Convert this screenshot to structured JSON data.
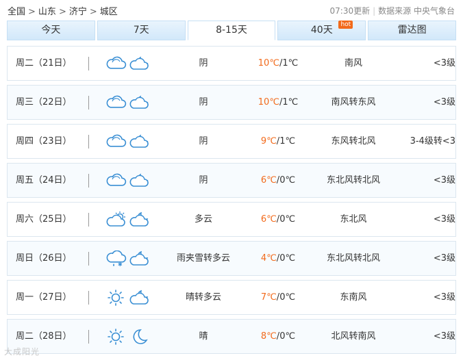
{
  "breadcrumb": {
    "items": [
      "全国",
      "山东",
      "济宁",
      "城区"
    ],
    "separator": ">"
  },
  "update": {
    "time": "07:30更新",
    "source": "数据来源 中央气象台"
  },
  "tabs": [
    {
      "label": "今天",
      "active": false
    },
    {
      "label": "7天",
      "active": false
    },
    {
      "label": "8-15天",
      "active": true
    },
    {
      "label": "40天",
      "active": false,
      "badge": "hot"
    },
    {
      "label": "雷达图",
      "active": false
    }
  ],
  "forecast": [
    {
      "day": "周二（21日）",
      "icon_day": "cloudy-icon",
      "icon_night": "cloudy-moon-icon",
      "desc": "阴",
      "hi": "10℃",
      "lo": "1℃",
      "wind": "南风",
      "level": "<3级"
    },
    {
      "day": "周三（22日）",
      "icon_day": "cloudy-icon",
      "icon_night": "cloudy-moon-icon",
      "desc": "阴",
      "hi": "10℃",
      "lo": "1℃",
      "wind": "南风转东风",
      "level": "<3级"
    },
    {
      "day": "周四（23日）",
      "icon_day": "cloudy-icon",
      "icon_night": "cloudy-moon-icon",
      "desc": "阴",
      "hi": "9℃",
      "lo": "1℃",
      "wind": "东风转北风",
      "level": "3-4级转<3"
    },
    {
      "day": "周五（24日）",
      "icon_day": "cloudy-icon",
      "icon_night": "cloudy-moon-icon",
      "desc": "阴",
      "hi": "6℃",
      "lo": "0℃",
      "wind": "东北风转北风",
      "level": "<3级"
    },
    {
      "day": "周六（25日）",
      "icon_day": "partly-cloudy-sun-icon",
      "icon_night": "partly-cloudy-moon-icon",
      "desc": "多云",
      "hi": "6℃",
      "lo": "0℃",
      "wind": "东北风",
      "level": "<3级"
    },
    {
      "day": "周日（26日）",
      "icon_day": "sleet-icon",
      "icon_night": "partly-cloudy-moon-icon",
      "desc": "雨夹雪转多云",
      "hi": "4℃",
      "lo": "0℃",
      "wind": "东北风转北风",
      "level": "<3级"
    },
    {
      "day": "周一（27日）",
      "icon_day": "sunny-icon",
      "icon_night": "partly-cloudy-moon-icon",
      "desc": "晴转多云",
      "hi": "7℃",
      "lo": "0℃",
      "wind": "东南风",
      "level": "<3级"
    },
    {
      "day": "周二（28日）",
      "icon_day": "sunny-icon",
      "icon_night": "moon-icon",
      "desc": "晴",
      "hi": "8℃",
      "lo": "0℃",
      "wind": "北风转南风",
      "level": "<3级"
    }
  ],
  "watermark": "大成阳光",
  "colors": {
    "accent": "#f26a1b",
    "icon": "#3a8fd4",
    "tab_bg": "#d2e8fa"
  }
}
